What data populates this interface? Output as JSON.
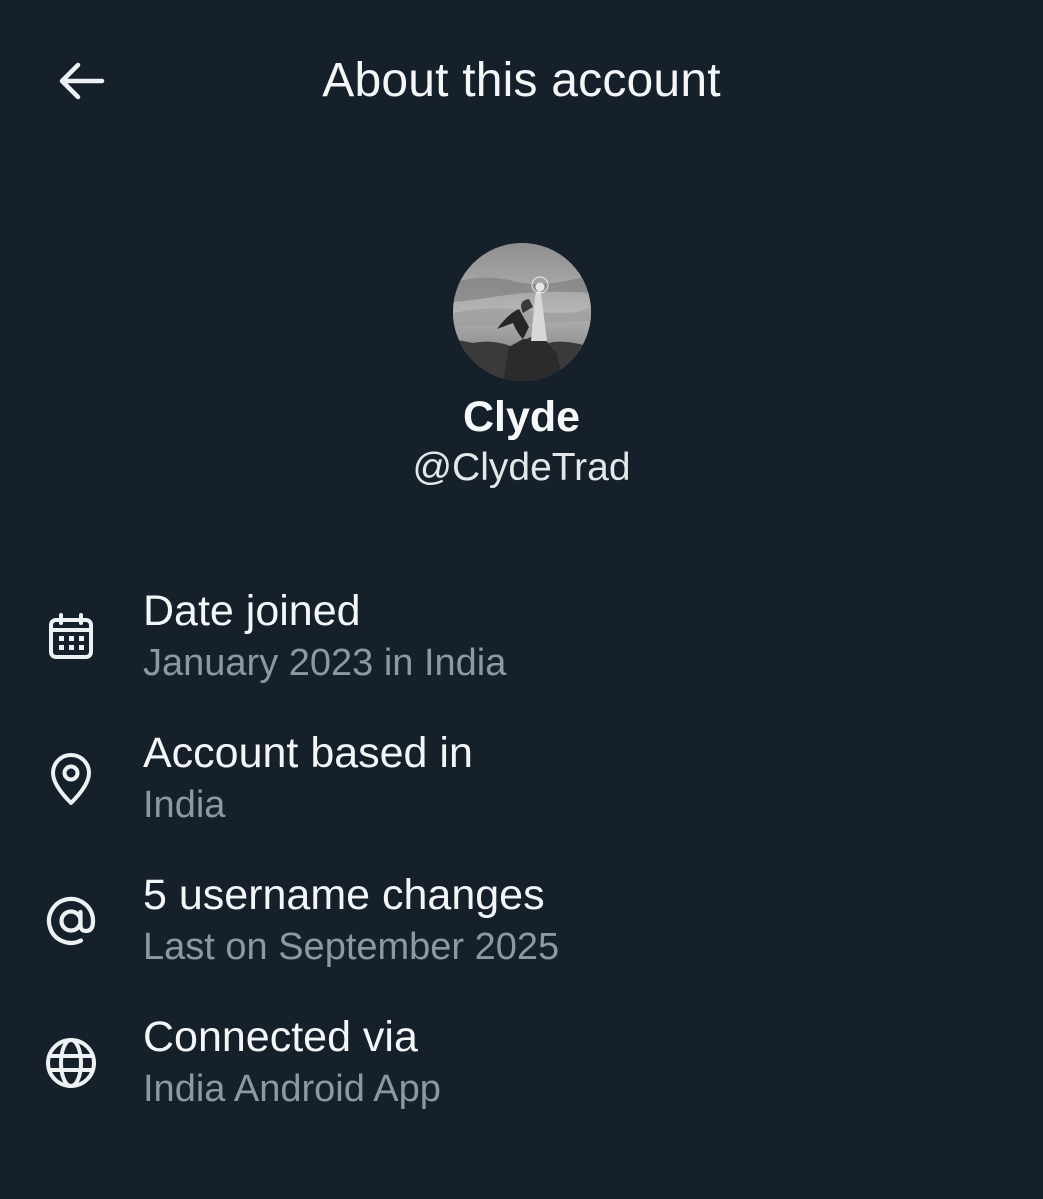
{
  "header": {
    "title": "About this account",
    "back_icon": "arrow-left-icon"
  },
  "profile": {
    "display_name": "Clyde",
    "handle": "@ClydeTrad",
    "avatar": "engraving-figure-on-rocky-cliff"
  },
  "rows": [
    {
      "icon": "calendar-icon",
      "title": "Date joined",
      "subtitle": "January 2023 in India"
    },
    {
      "icon": "location-pin-icon",
      "title": "Account based in",
      "subtitle": "India"
    },
    {
      "icon": "at-sign-icon",
      "title": "5 username changes",
      "subtitle": "Last on September 2025"
    },
    {
      "icon": "globe-icon",
      "title": "Connected via",
      "subtitle": "India Android App"
    }
  ],
  "colors": {
    "background": "#16202a",
    "primary_text": "#f3f5f7",
    "secondary_text": "#8b98a5"
  }
}
